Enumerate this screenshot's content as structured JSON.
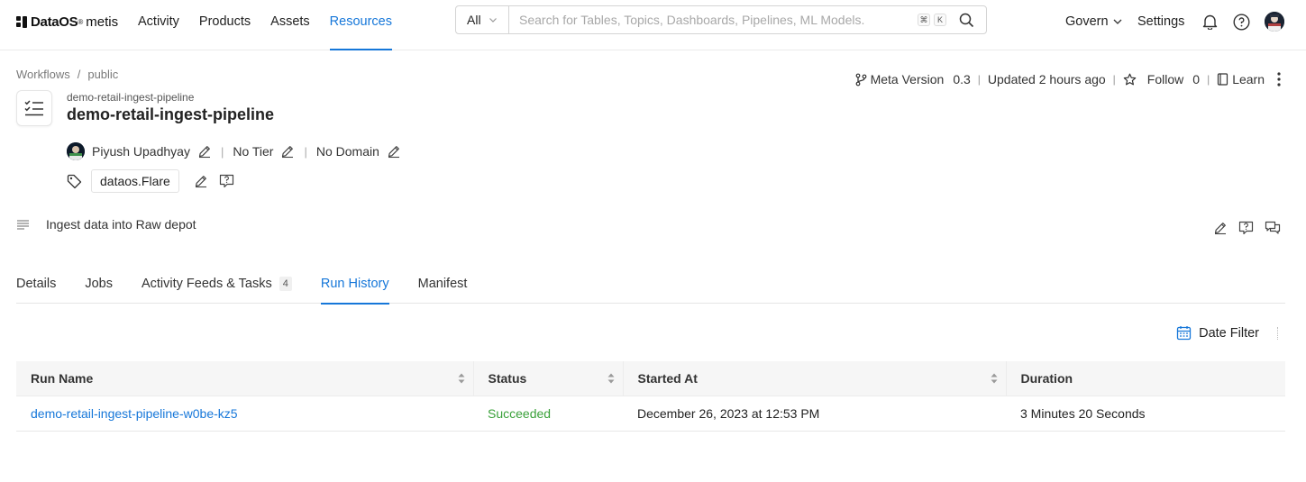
{
  "nav": {
    "brand": "DataOS",
    "brand_sup": "®",
    "brand_sub": "metis",
    "links": [
      "Activity",
      "Products",
      "Assets",
      "Resources"
    ],
    "active_link": "Resources",
    "search_scope": "All",
    "search_placeholder": "Search for Tables, Topics, Dashboards, Pipelines, ML Models.",
    "kbd_cmd": "⌘",
    "kbd_k": "K",
    "govern": "Govern",
    "settings": "Settings"
  },
  "breadcrumb": {
    "items": [
      "Workflows",
      "public"
    ],
    "separator": "/"
  },
  "entity": {
    "subtitle": "demo-retail-ingest-pipeline",
    "title": "demo-retail-ingest-pipeline"
  },
  "meta": {
    "meta_version_label": "Meta Version",
    "meta_version_value": "0.3",
    "updated": "Updated 2 hours ago",
    "follow_label": "Follow",
    "follow_count": "0",
    "learn_label": "Learn"
  },
  "owner": {
    "name": "Piyush Upadhyay",
    "tier": "No Tier",
    "domain": "No Domain"
  },
  "tags": [
    "dataos.Flare"
  ],
  "description": "Ingest data into Raw depot",
  "tabs": [
    {
      "label": "Details"
    },
    {
      "label": "Jobs"
    },
    {
      "label": "Activity Feeds & Tasks",
      "count": "4"
    },
    {
      "label": "Run History"
    },
    {
      "label": "Manifest"
    }
  ],
  "active_tab": "Run History",
  "date_filter_label": "Date Filter",
  "table": {
    "columns": [
      "Run Name",
      "Status",
      "Started At",
      "Duration"
    ],
    "rows": [
      {
        "run_name": "demo-retail-ingest-pipeline-w0be-kz5",
        "status": "Succeeded",
        "started_at": "December 26, 2023 at 12:53 PM",
        "duration": "3 Minutes 20 Seconds"
      }
    ]
  },
  "colors": {
    "accent": "#1677d9",
    "success": "#3aa13a",
    "header_bg": "#f6f6f6"
  }
}
